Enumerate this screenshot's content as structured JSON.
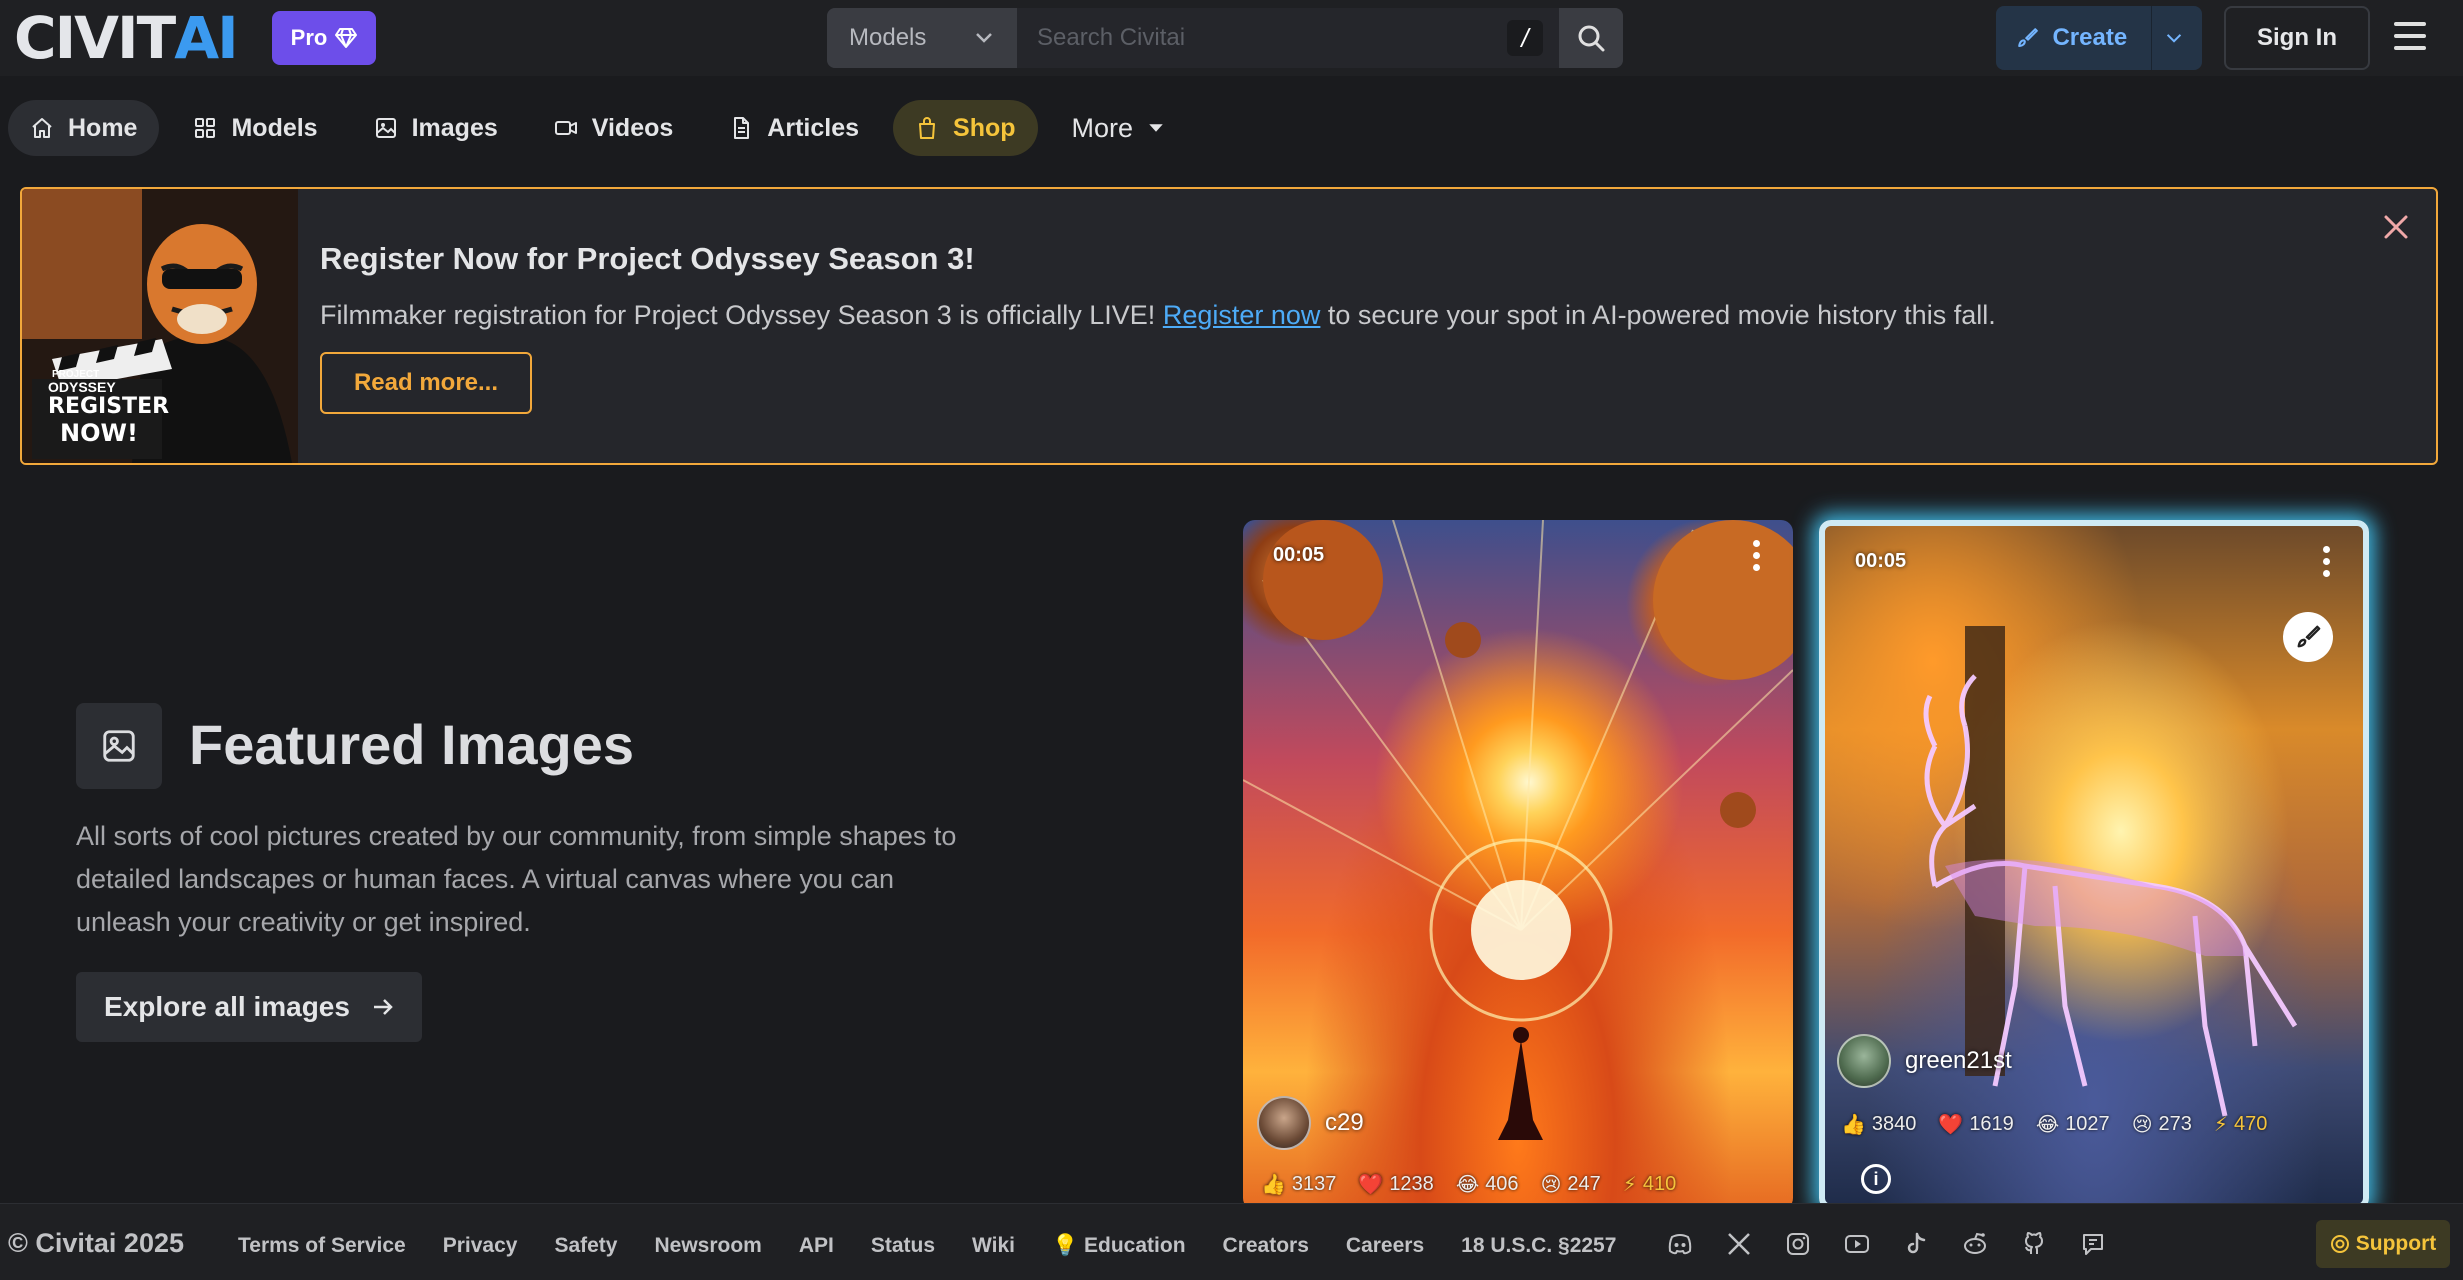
{
  "header": {
    "logo_left": "CIVIT",
    "logo_right": "AI",
    "pro_label": "Pro",
    "search_scope": "Models",
    "search_placeholder": "Search Civitai",
    "search_shortcut": "/",
    "create_label": "Create",
    "signin_label": "Sign In"
  },
  "nav": {
    "items": [
      {
        "label": "Home",
        "icon": "home-icon"
      },
      {
        "label": "Models",
        "icon": "grid-icon"
      },
      {
        "label": "Images",
        "icon": "image-icon"
      },
      {
        "label": "Videos",
        "icon": "video-icon"
      },
      {
        "label": "Articles",
        "icon": "article-icon"
      },
      {
        "label": "Shop",
        "icon": "shopping-bag-icon"
      },
      {
        "label": "More",
        "icon": "caret-down-icon"
      }
    ]
  },
  "banner": {
    "title": "Register Now for Project Odyssey Season 3!",
    "text_before": "Filmmaker registration for Project Odyssey Season 3 is officially LIVE! ",
    "link_text": "Register now",
    "text_after": " to secure your spot in AI-powered movie history this fall.",
    "button_label": "Read more...",
    "image_caption_small": "PROJECT",
    "image_caption_brand": "ODYSSEY",
    "image_caption_big1": "REGISTER",
    "image_caption_big2": "NOW!",
    "accent_color": "#f2a83b"
  },
  "featured": {
    "title": "Featured Images",
    "description": "All sorts of cool pictures created by our community, from simple shapes to detailed landscapes or human faces. A virtual canvas where you can unleash your creativity or get inspired.",
    "button_label": "Explore all images"
  },
  "cards": [
    {
      "time": "00:05",
      "user": "c29",
      "reactions": {
        "like": "3137",
        "heart": "1238",
        "laugh": "406",
        "cry": "247",
        "buzz": "410"
      }
    },
    {
      "time": "00:05",
      "user": "green21st",
      "reactions": {
        "like": "3840",
        "heart": "1619",
        "laugh": "1027",
        "cry": "273",
        "buzz": "470"
      }
    }
  ],
  "footer": {
    "copyright": "© Civitai 2025",
    "links": [
      "Terms of Service",
      "Privacy",
      "Safety",
      "Newsroom",
      "API",
      "Status",
      "Wiki",
      "Education",
      "Creators",
      "Careers",
      "18 U.S.C. §2257"
    ],
    "social_icons": [
      "discord-icon",
      "x-icon",
      "instagram-icon",
      "youtube-icon",
      "tiktok-icon",
      "reddit-icon",
      "github-icon",
      "chat-icon"
    ],
    "support_label": "Support"
  }
}
